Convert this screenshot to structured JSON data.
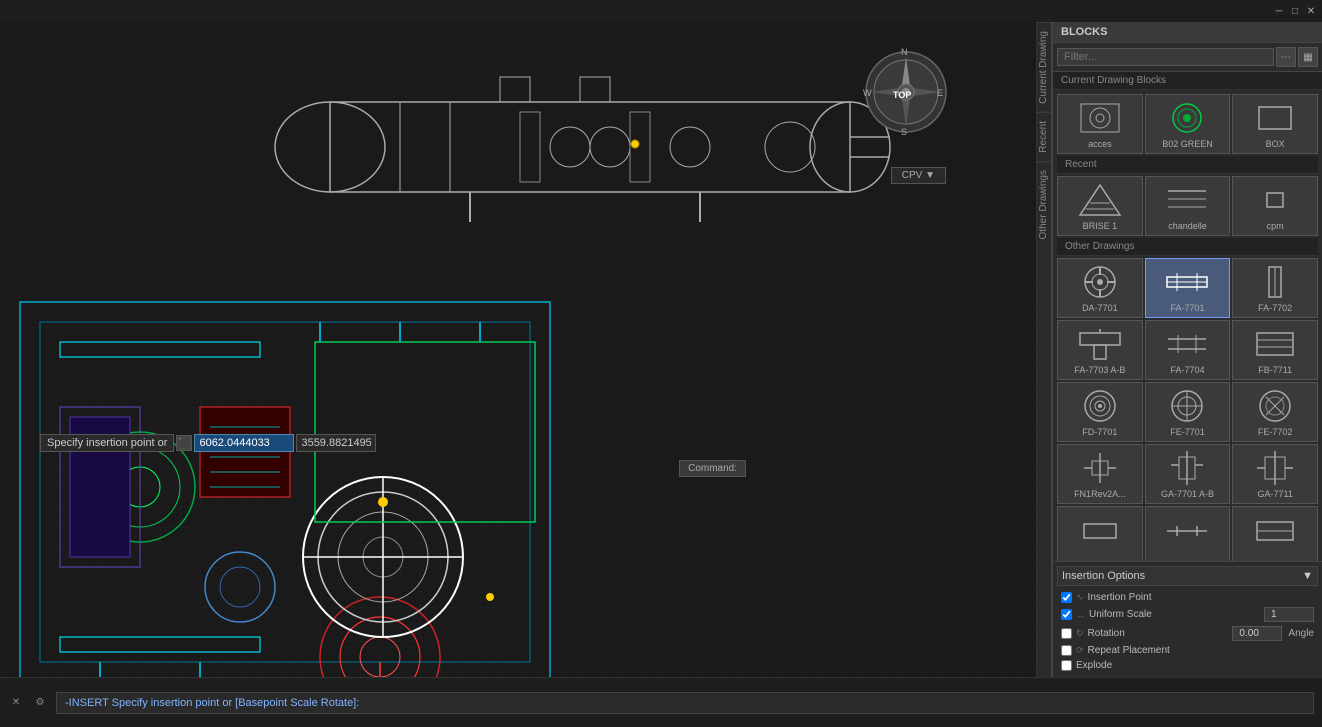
{
  "titlebar": {
    "minimize": "─",
    "restore": "□",
    "close": "✕"
  },
  "panel": {
    "title": "BLOCKS",
    "filter_placeholder": "Filter...",
    "sections": {
      "current": "Current Drawing Blocks",
      "recent": "Recent",
      "other": "Other Drawings"
    }
  },
  "blocks": [
    {
      "name": "acces",
      "type": "circle_square",
      "selected": false
    },
    {
      "name": "B02 GREEN",
      "type": "circle_detailed",
      "selected": false
    },
    {
      "name": "BOX",
      "type": "rectangle",
      "selected": false
    },
    {
      "name": "BRISE 1",
      "type": "triangle_lines",
      "selected": false
    },
    {
      "name": "chandelle",
      "type": "horizontal_lines",
      "selected": false
    },
    {
      "name": "cpm",
      "type": "small_rect",
      "selected": false
    },
    {
      "name": "DA-7701",
      "type": "gear_circle",
      "selected": false
    },
    {
      "name": "FA-7701",
      "type": "connector_h",
      "selected": true
    },
    {
      "name": "FA-7702",
      "type": "connector_v",
      "selected": false
    },
    {
      "name": "FA-7703 A-B",
      "type": "t_connector",
      "selected": false
    },
    {
      "name": "FA-7704",
      "type": "h_lines2",
      "selected": false
    },
    {
      "name": "FB-7711",
      "type": "rect_lines",
      "selected": false
    },
    {
      "name": "FD-7701",
      "type": "gear_circle2",
      "selected": false
    },
    {
      "name": "FE-7701",
      "type": "gear_circle3",
      "selected": false
    },
    {
      "name": "FE-7702",
      "type": "gear_circle4",
      "selected": false
    },
    {
      "name": "FN1Rev2A...",
      "type": "valves",
      "selected": false
    },
    {
      "name": "GA-7701 A-B",
      "type": "tall_connector",
      "selected": false
    },
    {
      "name": "GA-7711",
      "type": "tall_connector2",
      "selected": false
    }
  ],
  "thumbnails": [
    {
      "name": "thumb1",
      "type": "rect_small"
    },
    {
      "name": "thumb2",
      "type": "h_line_sym"
    },
    {
      "name": "thumb3",
      "type": "rect_sym"
    }
  ],
  "insertion_options": {
    "title": "Insertion Options",
    "insertion_point_label": "Insertion Point",
    "uniform_scale_label": "Uniform Scale",
    "uniform_scale_value": "1",
    "rotation_label": "Rotation",
    "rotation_value": "0.00",
    "angle_label": "Angle",
    "repeat_placement_label": "Repeat Placement",
    "explode_label": "Explode"
  },
  "input_bar": {
    "label": "Specify insertion point or",
    "coord1": "6062.0444033",
    "coord2": "3559.8821495"
  },
  "command": {
    "label": "Command:",
    "text": "-INSERT Specify insertion point or [Basepoint Scale Rotate]:"
  },
  "compass": {
    "top": "TOP",
    "north": "N",
    "south": "S",
    "east": "E",
    "west": "W"
  },
  "cpv": "CPV ▼",
  "side_tabs": [
    "Current Drawing",
    "Recent",
    "Other Drawings"
  ]
}
